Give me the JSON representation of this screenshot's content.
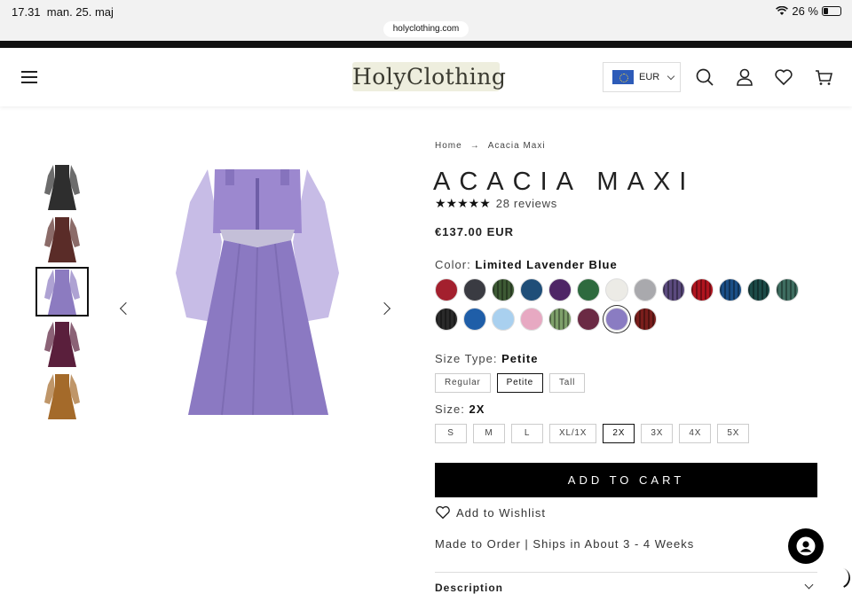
{
  "status": {
    "time": "17.31",
    "date": "man. 25. maj",
    "battery": "26 %"
  },
  "browser": {
    "url": "holyclothing.com"
  },
  "header": {
    "logo": "HolyClothing",
    "currency": "EUR"
  },
  "breadcrumb": {
    "home": "Home",
    "separator": "→",
    "current": "Acacia Maxi"
  },
  "product": {
    "title": "ACACIA MAXI",
    "stars": "★★★★★",
    "reviews": "28 reviews",
    "price": "€137.00 EUR",
    "color_label": "Color:",
    "color_value": "Limited Lavender Blue",
    "size_type_label": "Size Type:",
    "size_type_value": "Petite",
    "size_label": "Size:",
    "size_value": "2X",
    "add_to_cart": "ADD TO CART",
    "wishlist": "Add to Wishlist",
    "shipping": "Made to Order | Ships in About 3 - 4 Weeks",
    "description": "Description"
  },
  "size_types": [
    "Regular",
    "Petite",
    "Tall"
  ],
  "selected_size_type": 1,
  "sizes": [
    "S",
    "M",
    "L",
    "XL/1X",
    "2X",
    "3X",
    "4X",
    "5X"
  ],
  "selected_size": 4,
  "swatches": [
    {
      "color": "#a3202e",
      "striped": false
    },
    {
      "color": "#3a3b42",
      "striped": false
    },
    {
      "color": "#3d5a34",
      "striped": true
    },
    {
      "color": "#1f4e78",
      "striped": false
    },
    {
      "color": "#4e2566",
      "striped": false
    },
    {
      "color": "#2e6a3e",
      "striped": false
    },
    {
      "color": "#ecebe6",
      "striped": false
    },
    {
      "color": "#a9a9ad",
      "striped": false
    },
    {
      "color": "#5b4a7e",
      "striped": true
    },
    {
      "color": "#b0141e",
      "striped": true
    },
    {
      "color": "#1a4e86",
      "striped": true
    },
    {
      "color": "#1c4b48",
      "striped": true
    },
    {
      "color": "#3e6d60",
      "striped": true
    },
    {
      "color": "#2a2a2a",
      "striped": true
    },
    {
      "color": "#1f5ea8",
      "striped": false
    },
    {
      "color": "#a9d0ef",
      "striped": false
    },
    {
      "color": "#e7a9c2",
      "striped": false
    },
    {
      "color": "#7ea06a",
      "striped": true
    },
    {
      "color": "#6b2a44",
      "striped": false
    },
    {
      "color": "#8a7cc2",
      "striped": false,
      "active": true
    },
    {
      "color": "#7a1e1c",
      "striped": true
    }
  ],
  "thumbnails": [
    "#2e2e2e",
    "#5a2c28",
    "#8c7bc0",
    "#5a1f3c",
    "#a46a2a"
  ],
  "selected_thumbnail": 2
}
